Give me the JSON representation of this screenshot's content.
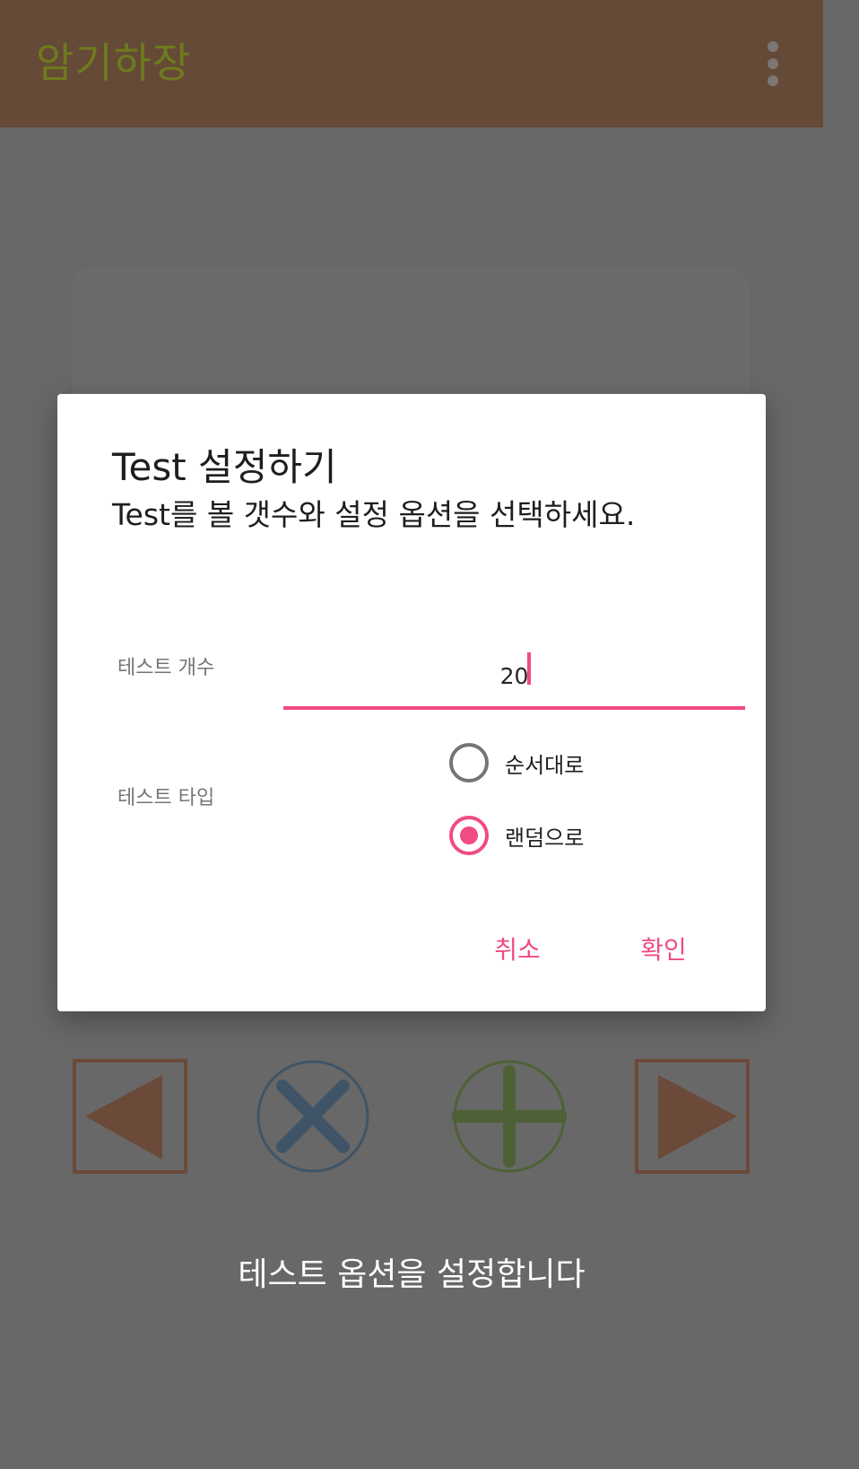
{
  "appbar": {
    "title": "암기하장",
    "menu_icon": "more-vert-icon"
  },
  "dialog": {
    "title": "Test 설정하기",
    "message": "Test를 볼 갯수와 설정 옵션을 선택하세요.",
    "count_label": "테스트 개수",
    "count_value": "20",
    "type_label": "테스트 타입",
    "type_options": [
      {
        "label": "순서대로",
        "checked": false
      },
      {
        "label": "랜덤으로",
        "checked": true
      }
    ],
    "cancel_label": "취소",
    "ok_label": "확인"
  },
  "controls": {
    "prev_icon": "triangle-left-icon",
    "delete_icon": "x-circle-icon",
    "add_icon": "plus-circle-icon",
    "next_icon": "triangle-right-icon"
  },
  "footer": {
    "caption": "테스트 옵션을 설정합니다"
  },
  "colors": {
    "appbar": "#644a37",
    "app_title": "#6f7a1d",
    "scrim_background": "#686868",
    "accent_pink": "#ef4b84",
    "prev_next": "#6b4a39",
    "delete": "#3f5567",
    "add": "#4e6136"
  }
}
